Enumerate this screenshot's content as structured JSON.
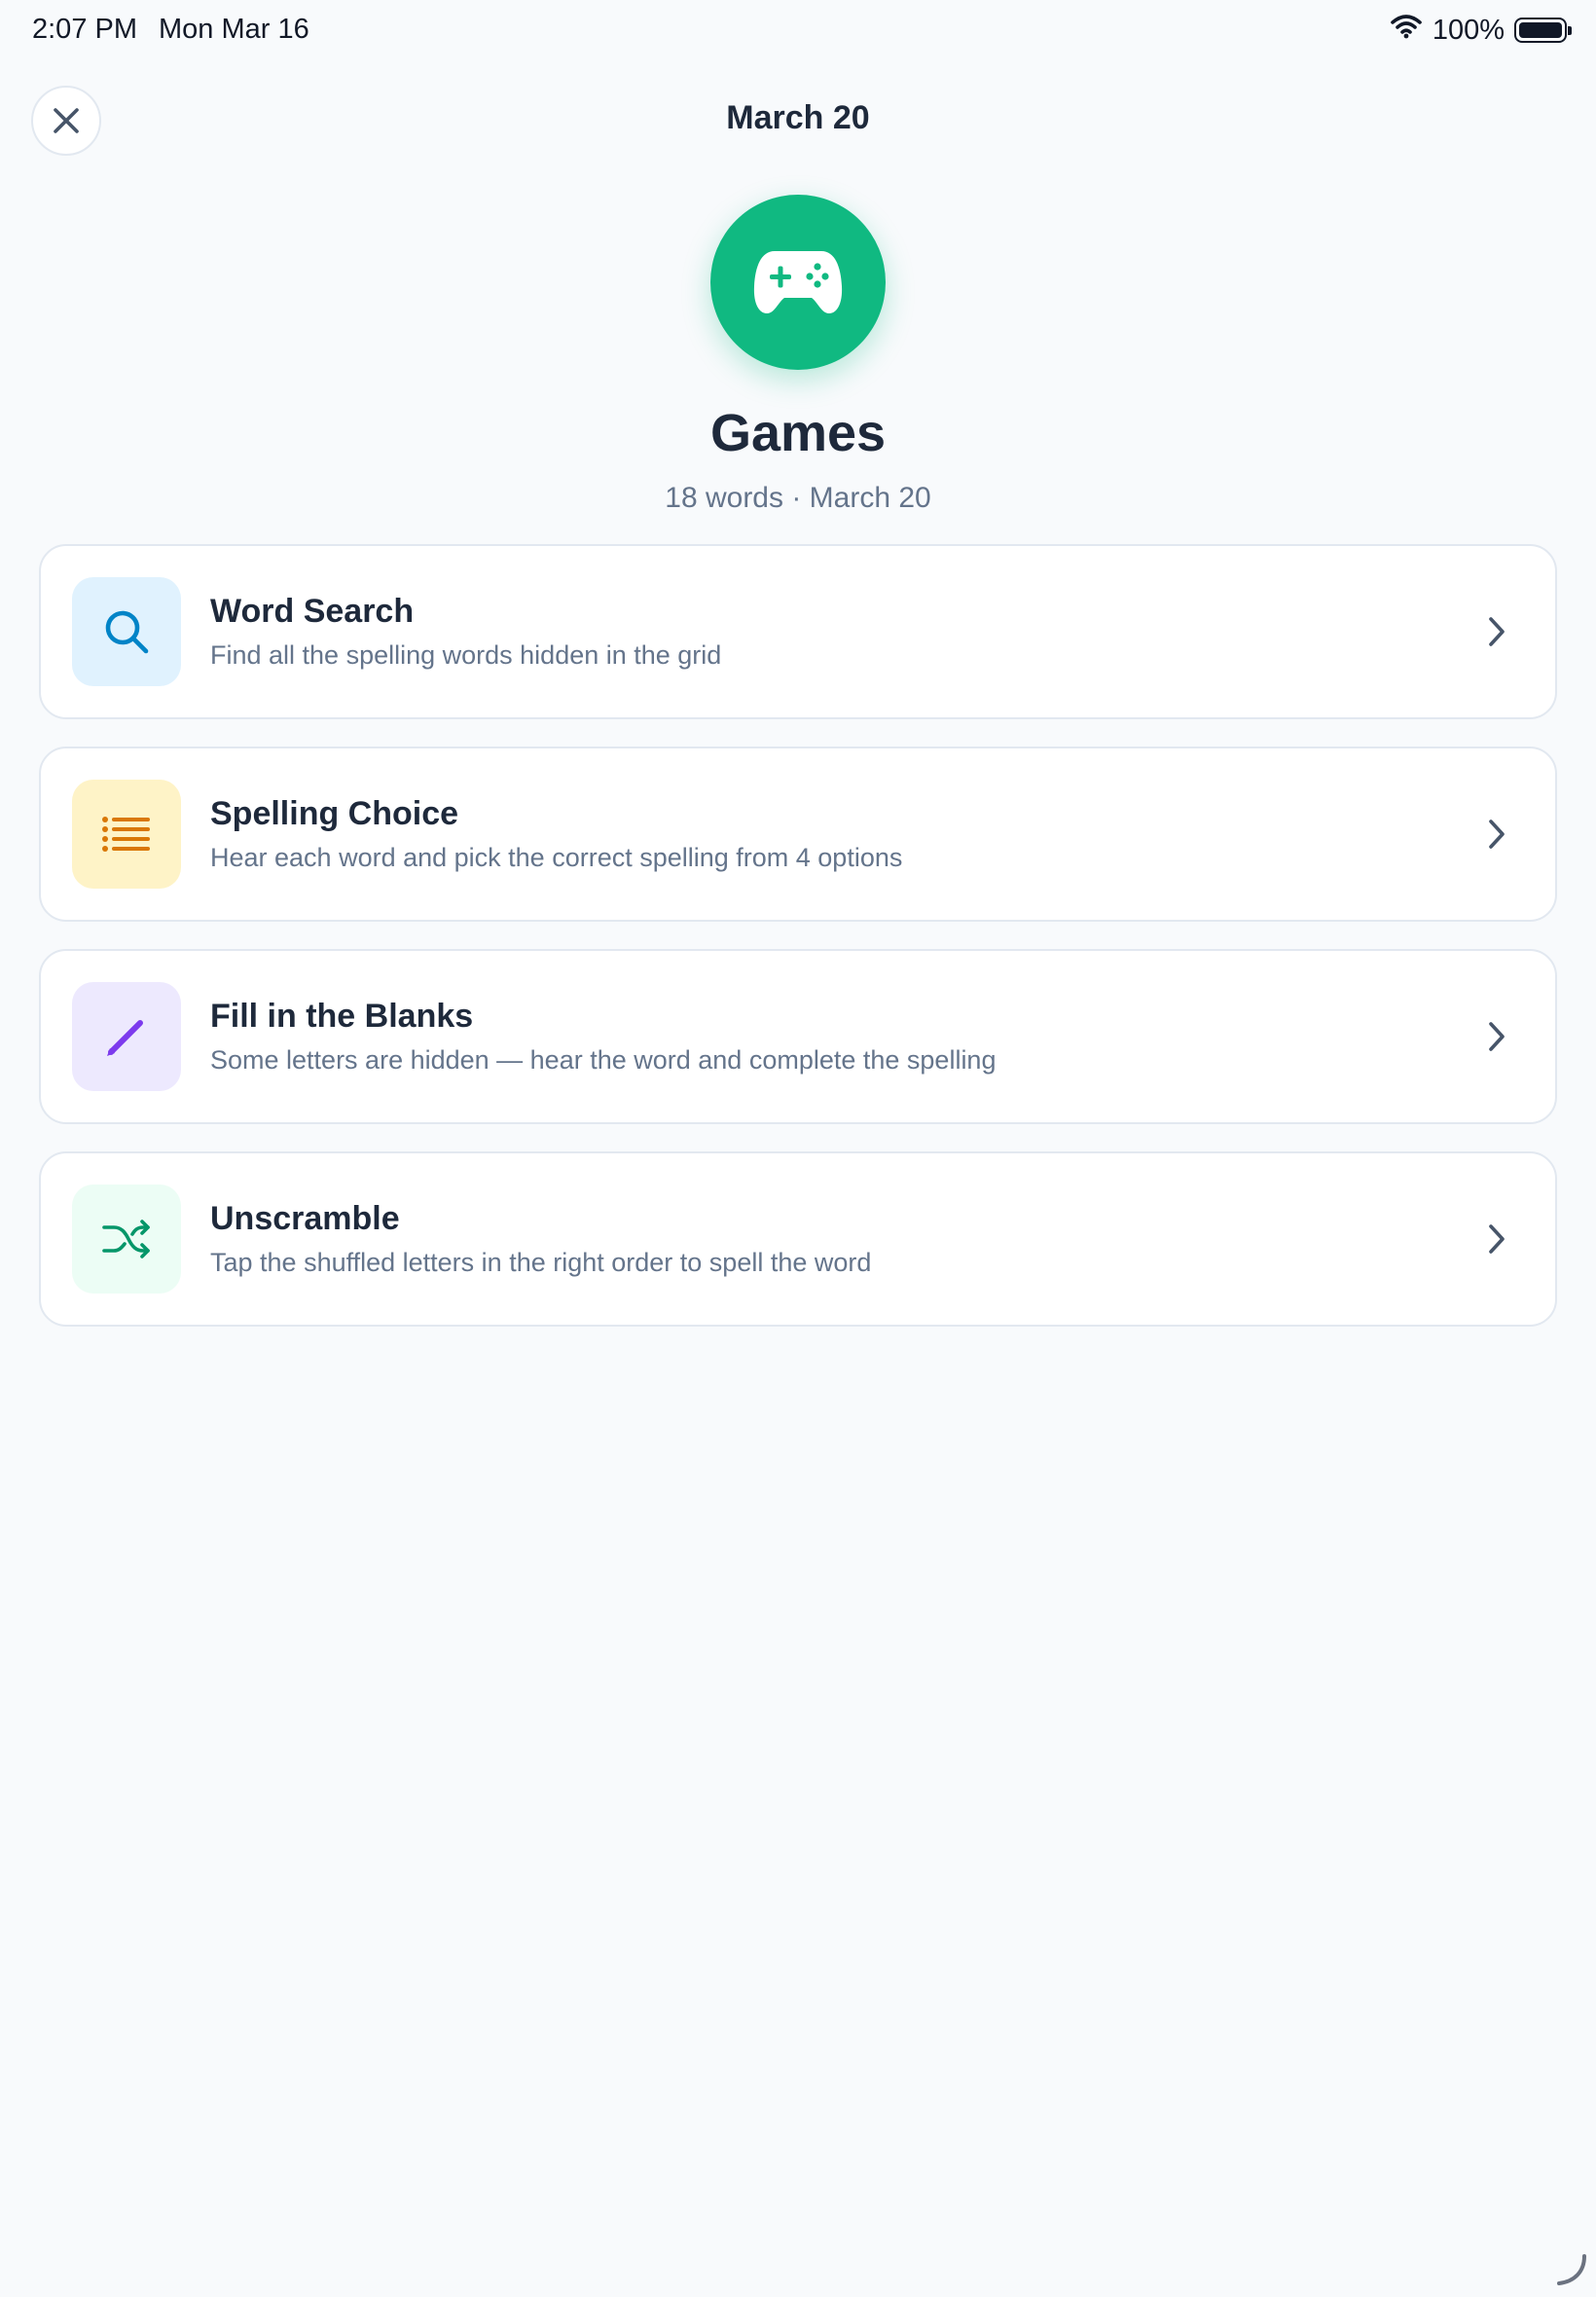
{
  "status_bar": {
    "time": "2:07 PM",
    "date": "Mon Mar 16",
    "battery": "100%"
  },
  "header": {
    "title": "March 20"
  },
  "hero": {
    "title": "Games",
    "subtitle": "18 words · March 20",
    "icon": "gamepad-icon",
    "color": "#10b981"
  },
  "games": [
    {
      "title": "Word Search",
      "description": "Find all the spelling words hidden in the grid",
      "icon": "search-icon",
      "icon_bg": "#e0f2fe",
      "icon_color": "#0284c7"
    },
    {
      "title": "Spelling Choice",
      "description": "Hear each word and pick the correct spelling from 4 options",
      "icon": "list-icon",
      "icon_bg": "#fef3c7",
      "icon_color": "#d97706"
    },
    {
      "title": "Fill in the Blanks",
      "description": "Some letters are hidden — hear the word and complete the spelling",
      "icon": "pencil-icon",
      "icon_bg": "#ede9fe",
      "icon_color": "#7c3aed"
    },
    {
      "title": "Unscramble",
      "description": "Tap the shuffled letters in the right order to spell the word",
      "icon": "shuffle-icon",
      "icon_bg": "#ecfdf5",
      "icon_color": "#059669"
    }
  ]
}
